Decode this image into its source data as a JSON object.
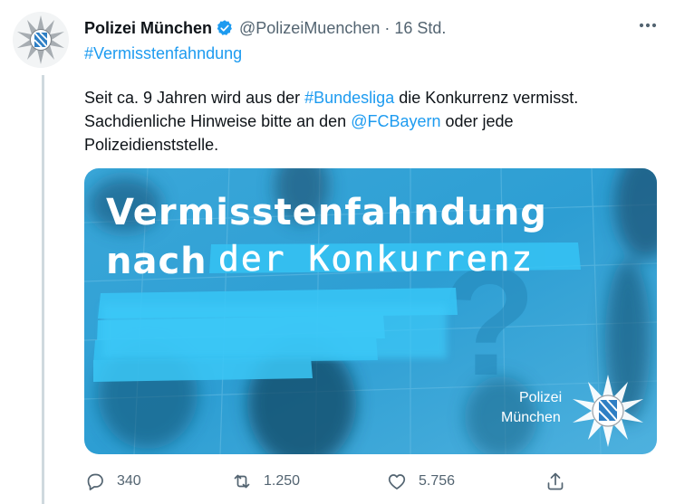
{
  "tweet": {
    "display_name": "Polizei München",
    "handle": "@PolizeiMuenchen",
    "separator": "·",
    "time": "16 Std.",
    "hashtag": "#Vermisstenfahndung",
    "text": {
      "part1": "Seit ca. 9 Jahren wird aus der ",
      "hashtag_bundesliga": "#Bundesliga",
      "part2": " die Konkurrenz vermisst. Sachdienliche Hinweise bitte an den ",
      "mention": "@FCBayern",
      "part3": " oder jede Polizeidienststelle."
    },
    "media": {
      "headline1": "Vermisstenfahndung",
      "headline2_printed": "nach",
      "headline2_handwritten": "der Konkurrenz",
      "question_mark": "?",
      "logo_line1": "Polizei",
      "logo_line2": "München"
    },
    "actions": {
      "replies": "340",
      "retweets": "1.250",
      "likes": "5.756"
    }
  },
  "icons": [
    "police-star-icon",
    "verified-badge-icon",
    "more-icon",
    "reply-icon",
    "retweet-icon",
    "like-icon",
    "share-icon"
  ],
  "colors": {
    "link": "#1d9bf0",
    "secondary_text": "#536471",
    "media_blue": "#2aa4d8",
    "thread_line": "#cfd9de"
  }
}
